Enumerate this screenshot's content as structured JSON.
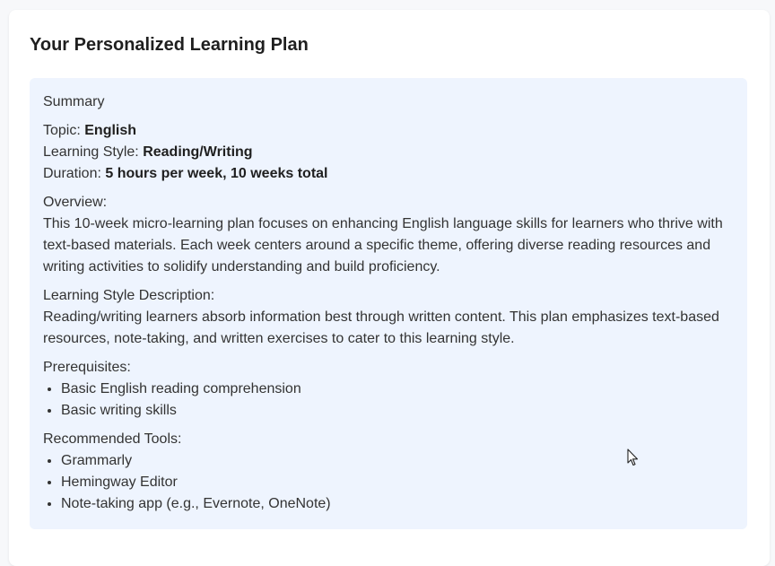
{
  "page": {
    "title": "Your Personalized Learning Plan"
  },
  "summary": {
    "heading": "Summary",
    "topic_label": "Topic: ",
    "topic_value": "English",
    "style_label": "Learning Style: ",
    "style_value": "Reading/Writing",
    "duration_label": "Duration: ",
    "duration_value": "5 hours per week, 10 weeks total",
    "overview_heading": "Overview:",
    "overview_text": "This 10-week micro-learning plan focuses on enhancing English language skills for learners who thrive with text-based materials. Each week centers around a specific theme, offering diverse reading resources and writing activities to solidify understanding and build proficiency.",
    "style_desc_heading": "Learning Style Description:",
    "style_desc_text": "Reading/writing learners absorb information best through written content. This plan emphasizes text-based resources, note-taking, and written exercises to cater to this learning style.",
    "prerequisites_heading": "Prerequisites:",
    "prerequisites": [
      "Basic English reading comprehension",
      "Basic writing skills"
    ],
    "tools_heading": "Recommended Tools:",
    "tools": [
      "Grammarly",
      "Hemingway Editor",
      "Note-taking app (e.g., Evernote, OneNote)"
    ]
  },
  "colors": {
    "panel_background": "#eef4fe",
    "page_background": "#f7f8fa"
  },
  "icons": {
    "cursor": "mouse-pointer-icon"
  }
}
